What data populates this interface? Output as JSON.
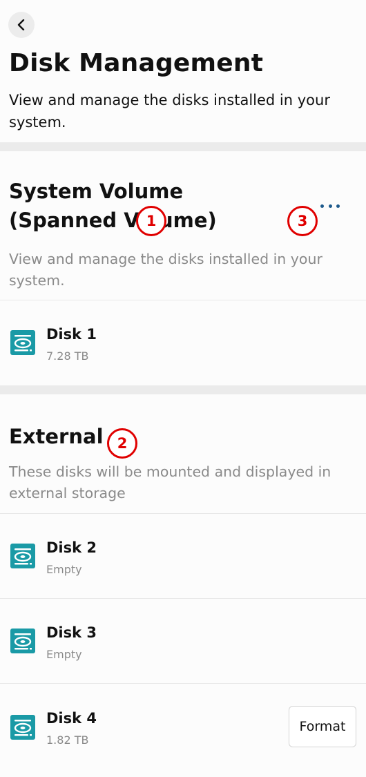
{
  "header": {
    "back_icon": "chevron-left-icon",
    "title": "Disk Management",
    "description": "View and manage the disks installed in your system."
  },
  "system_volume": {
    "title": "System Volume (Spanned Volume)",
    "description": "View and manage the disks installed in your system.",
    "more_icon": "more-horizontal-icon",
    "disks": [
      {
        "name": "Disk 1",
        "detail": "7.28 TB",
        "icon": "disk-drive-icon"
      }
    ]
  },
  "external": {
    "title": "External",
    "description": "These disks will be mounted and displayed in external storage",
    "disks": [
      {
        "name": "Disk 2",
        "detail": "Empty",
        "icon": "disk-drive-icon"
      },
      {
        "name": "Disk 3",
        "detail": "Empty",
        "icon": "disk-drive-icon"
      },
      {
        "name": "Disk 4",
        "detail": "1.82 TB",
        "icon": "disk-drive-icon",
        "action_label": "Format"
      }
    ]
  },
  "annotations": [
    "1",
    "2",
    "3"
  ],
  "colors": {
    "accent": "#1e5a8c",
    "disk_icon": "#1a9aa6",
    "annotation": "#e00000",
    "band": "#ebebeb",
    "muted_text": "#8a8a8a"
  }
}
